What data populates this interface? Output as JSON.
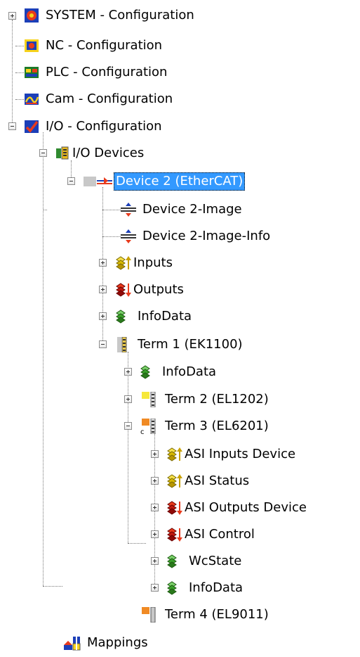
{
  "tree": {
    "system": {
      "label": "SYSTEM - Configuration",
      "icon": "system-config-icon"
    },
    "nc": {
      "label": "NC - Configuration",
      "icon": "nc-config-icon"
    },
    "plc": {
      "label": "PLC - Configuration",
      "icon": "plc-config-icon"
    },
    "cam": {
      "label": "Cam - Configuration",
      "icon": "cam-config-icon"
    },
    "io": {
      "label": "I/O - Configuration",
      "icon": "io-config-icon"
    },
    "io_devices": {
      "label": "I/O Devices",
      "icon": "io-devices-icon"
    },
    "device2": {
      "label": "Device 2 (EtherCAT)",
      "icon": "ethercat-device-icon",
      "selected": true
    },
    "device2_image": {
      "label": "Device 2-Image",
      "icon": "process-image-icon"
    },
    "device2_image_info": {
      "label": "Device 2-Image-Info",
      "icon": "process-image-icon"
    },
    "inputs": {
      "label": "Inputs",
      "icon": "inputs-icon"
    },
    "outputs": {
      "label": "Outputs",
      "icon": "outputs-icon"
    },
    "infodata": {
      "label": "InfoData",
      "icon": "infodata-icon"
    },
    "term1": {
      "label": "Term 1 (EK1100)",
      "icon": "coupler-terminal-icon"
    },
    "term1_infodata": {
      "label": "InfoData",
      "icon": "infodata-icon"
    },
    "term2": {
      "label": "Term 2 (EL1202)",
      "icon": "terminal-yellow-icon"
    },
    "term3": {
      "label": "Term 3 (EL6201)",
      "icon": "terminal-orange-icon"
    },
    "asi_inputs_device": {
      "label": "ASI Inputs Device",
      "icon": "inputs-icon"
    },
    "asi_status": {
      "label": "ASI Status",
      "icon": "inputs-icon"
    },
    "asi_outputs_device": {
      "label": "ASI Outputs Device",
      "icon": "outputs-icon"
    },
    "asi_control": {
      "label": "ASI Control",
      "icon": "outputs-icon"
    },
    "wcstate": {
      "label": "WcState",
      "icon": "infodata-icon"
    },
    "term3_infodata": {
      "label": "InfoData",
      "icon": "infodata-icon"
    },
    "term4": {
      "label": "Term 4 (EL9011)",
      "icon": "end-terminal-icon"
    },
    "mappings": {
      "label": "Mappings",
      "icon": "mappings-icon"
    }
  },
  "colors": {
    "selection": "#3399ff",
    "connector": "#777777",
    "text": "#000000"
  }
}
